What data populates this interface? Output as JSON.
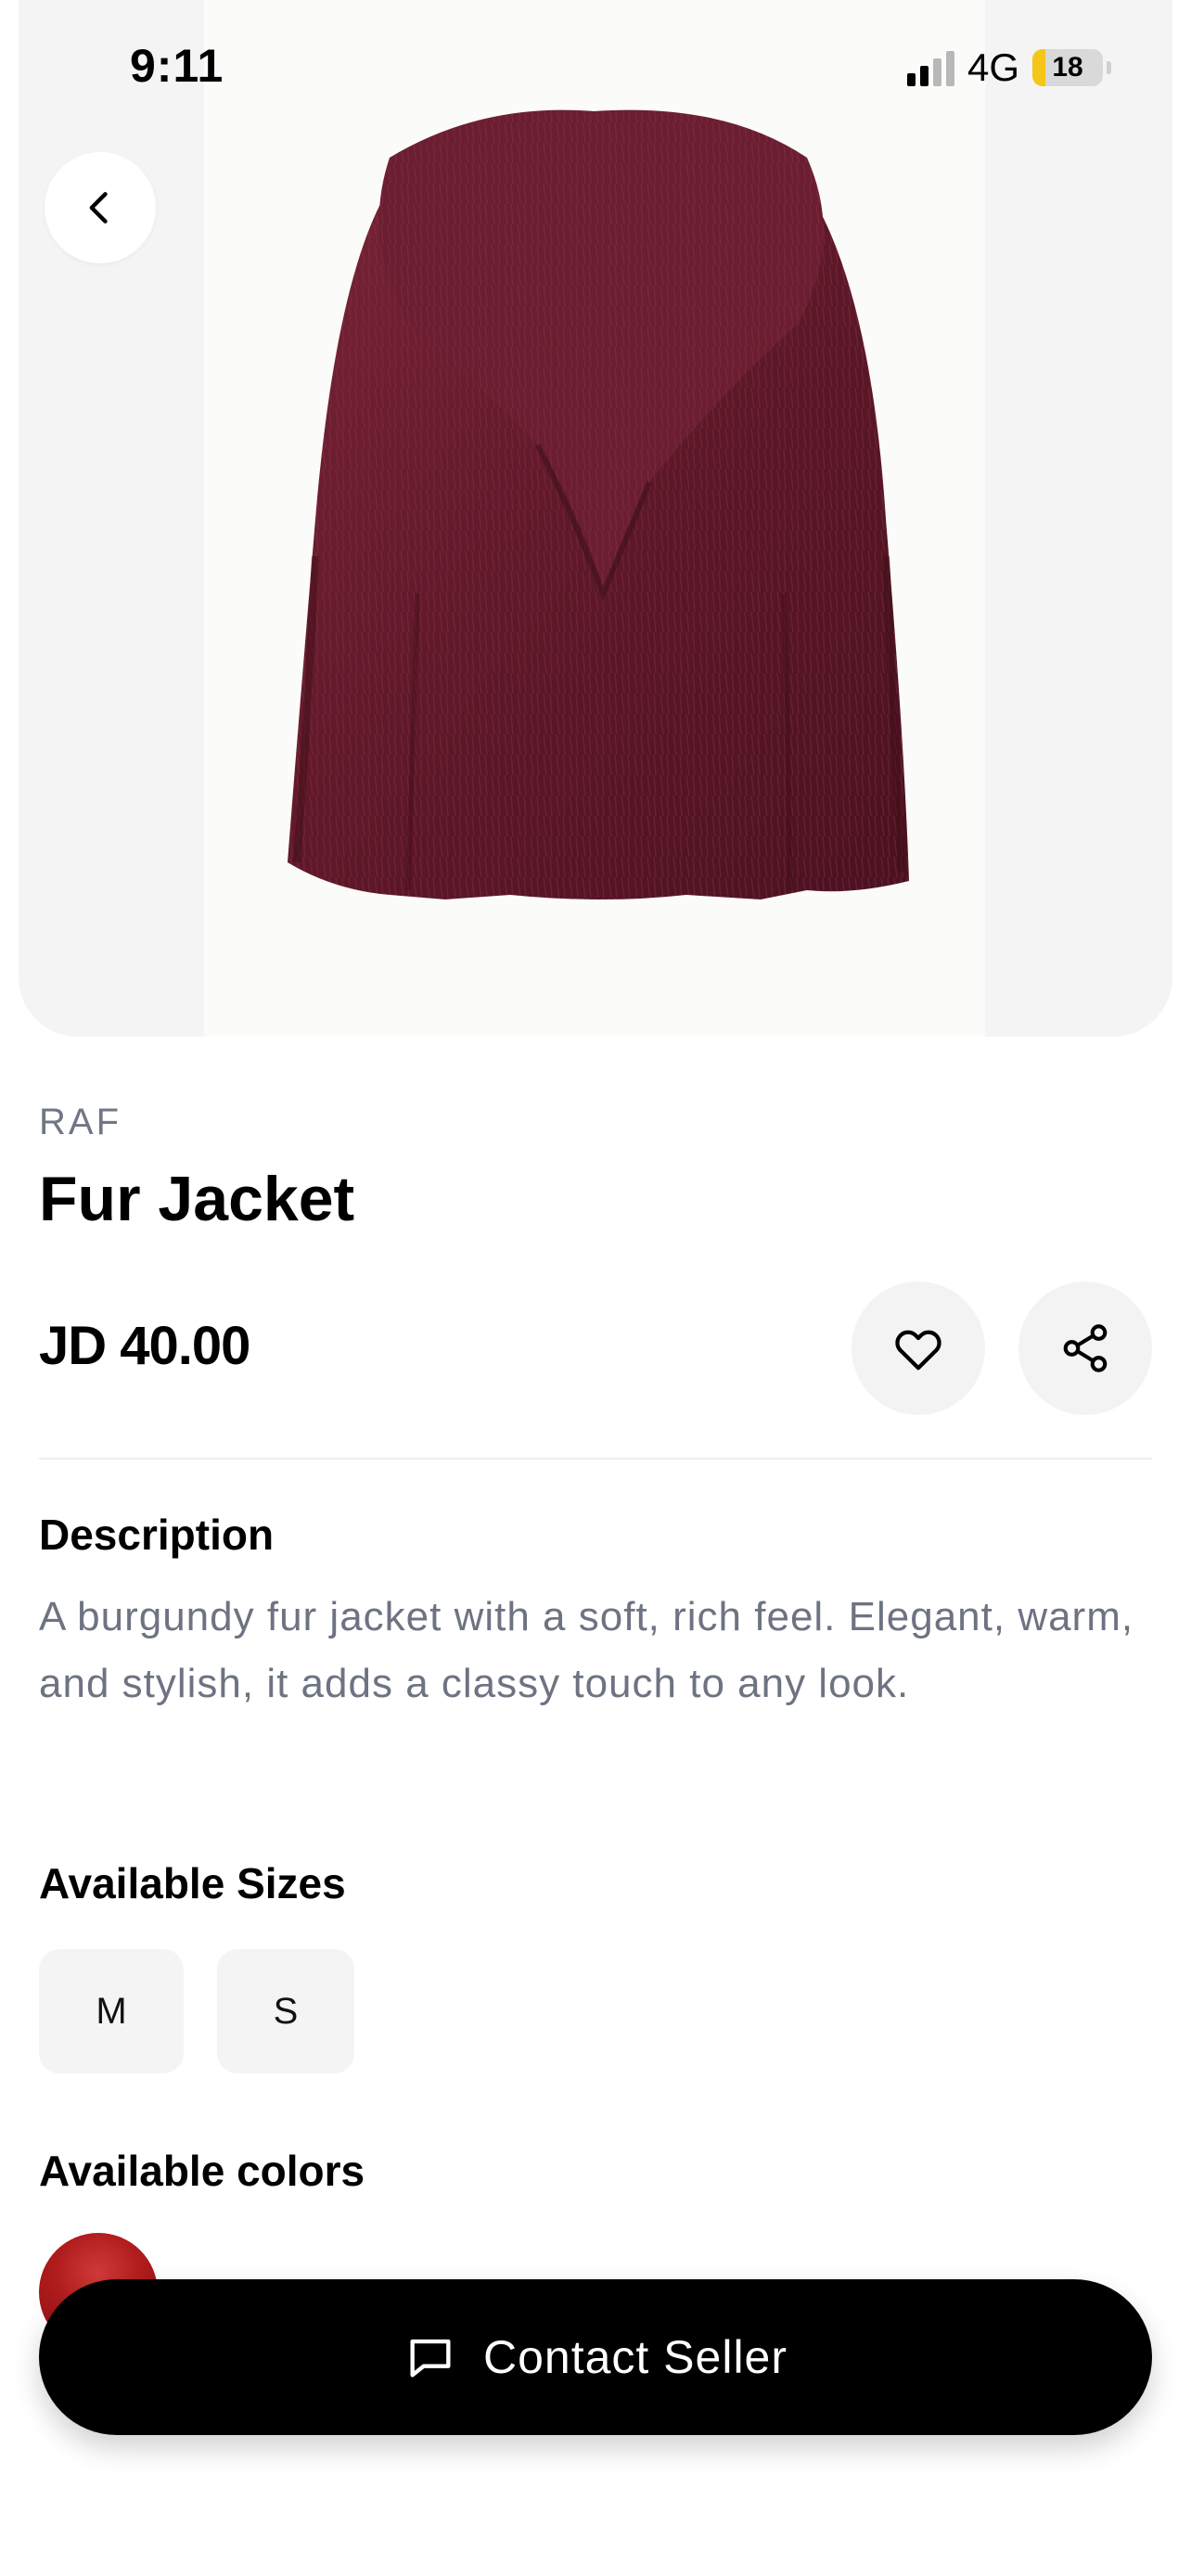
{
  "status_bar": {
    "time": "9:11",
    "network": "4G",
    "battery": "18",
    "battery_fill_percent": 18
  },
  "product": {
    "brand": "RAF",
    "title": "Fur Jacket",
    "price": "JD 40.00",
    "image_alt": "burgundy fur jacket",
    "jacket_color": "#6e1f33"
  },
  "description": {
    "heading": "Description",
    "text": "A burgundy fur jacket with a soft, rich feel. Elegant, warm, and stylish, it adds a classy touch to any look."
  },
  "sizes": {
    "heading": "Available Sizes",
    "options": [
      "M",
      "S"
    ]
  },
  "colors": {
    "heading": "Available colors",
    "options": [
      "#b01c1c"
    ]
  },
  "actions": {
    "contact_label": "Contact Seller",
    "back_icon": "chevron-left-icon",
    "favorite_icon": "heart-icon",
    "share_icon": "share-icon",
    "contact_icon": "chat-bubble-icon"
  }
}
